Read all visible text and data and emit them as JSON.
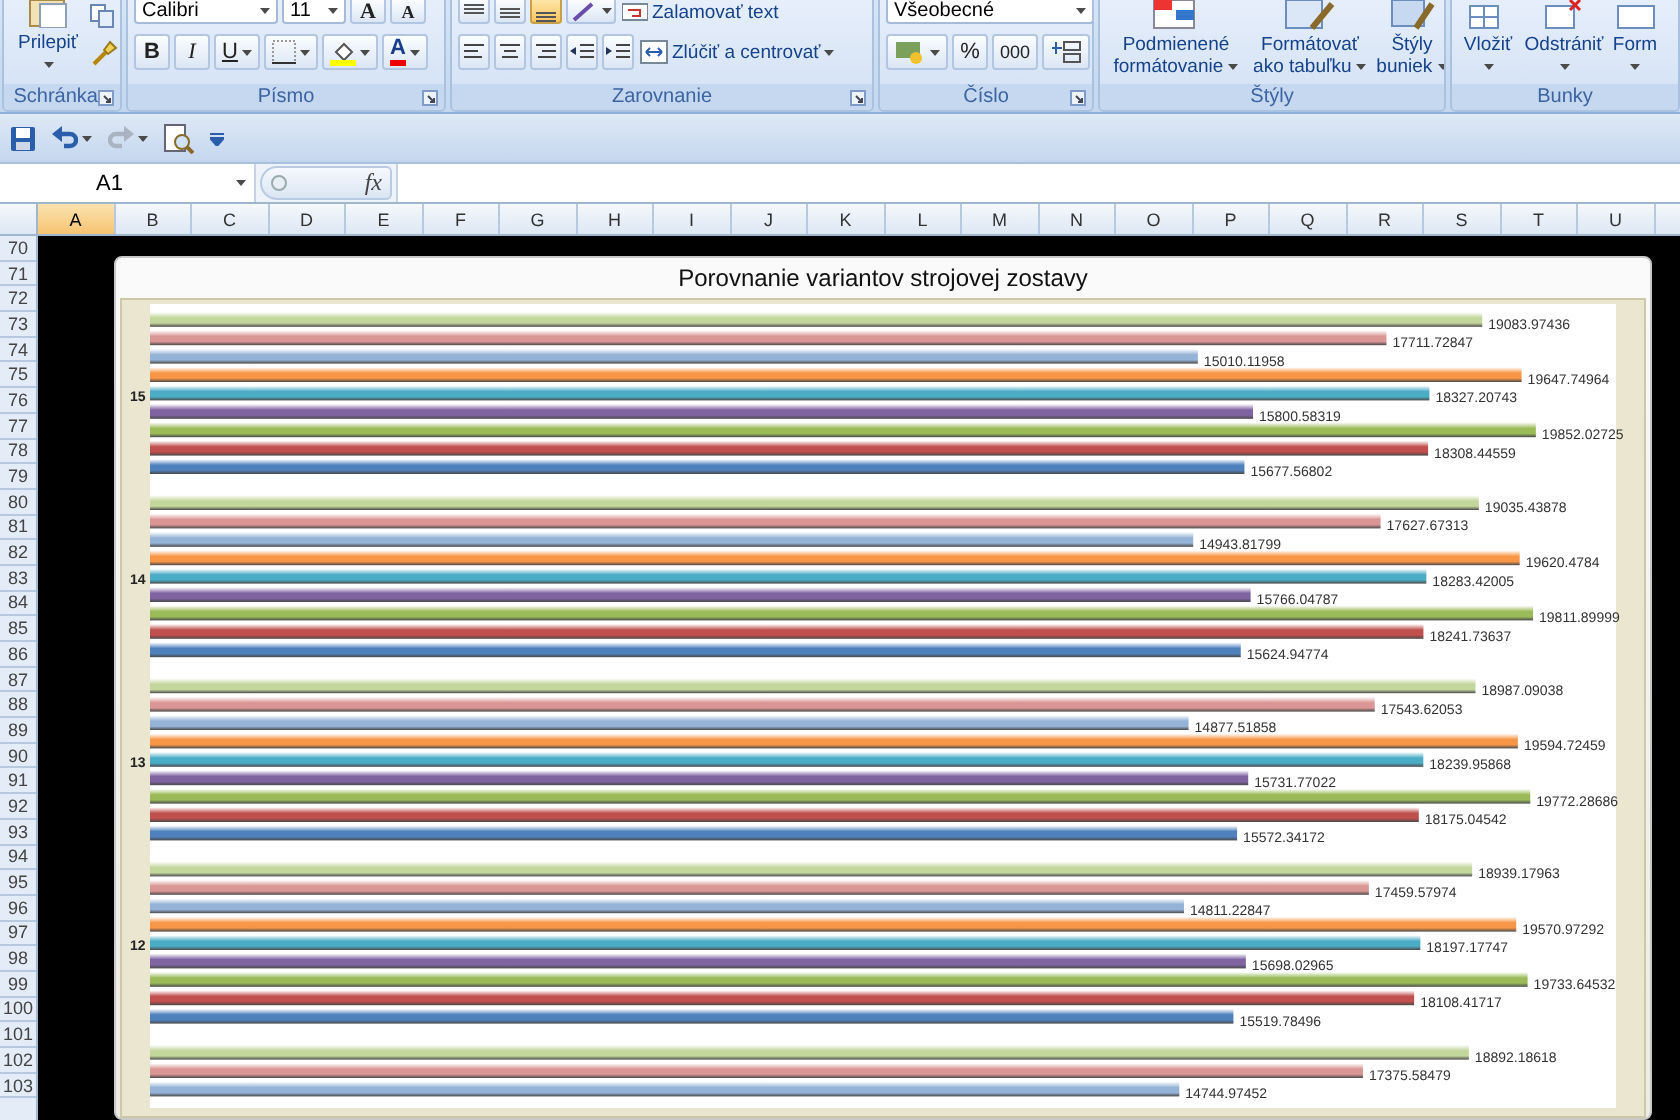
{
  "ribbon": {
    "groups": [
      {
        "kind": "clipboard",
        "label": "Schránka",
        "paste": "Prilepiť"
      },
      {
        "kind": "font",
        "label": "Písmo",
        "font_name": "Calibri",
        "font_size": "11",
        "grow": "A",
        "shrink": "A",
        "bold": "B",
        "italic": "I",
        "underline": "U",
        "font_color": "A"
      },
      {
        "kind": "alignment",
        "label": "Zarovnanie",
        "vertical_align": [
          {
            "selected": false
          },
          {
            "selected": false
          },
          {
            "selected": true
          }
        ],
        "wrap_text": "Zalamovať text",
        "merge": "Zlúčiť a centrovať"
      },
      {
        "kind": "number",
        "label": "Číslo",
        "format": "Všeobecné",
        "percent": "%",
        "thousands": "000"
      },
      {
        "kind": "styles",
        "label": "Štýly",
        "buttons": [
          "Podmienené formátovanie",
          "Formátovať ako tabuľku",
          "Štýly buniek"
        ]
      },
      {
        "kind": "cells",
        "label": "Bunky",
        "buttons": [
          "Vložiť",
          "Odstrániť",
          "Form"
        ]
      }
    ]
  },
  "quick_access": [
    {
      "kind": "save",
      "disabled": false
    },
    {
      "kind": "undo",
      "disabled": false
    },
    {
      "kind": "redo",
      "disabled": true
    },
    {
      "kind": "print_preview",
      "disabled": false
    },
    {
      "kind": "customize",
      "disabled": false
    }
  ],
  "formula_bar": {
    "name_box": "A1",
    "function_button": "fx"
  },
  "columns": [
    {
      "label": "A",
      "selected": true
    },
    {
      "label": "B",
      "selected": false
    },
    {
      "label": "C",
      "selected": false
    },
    {
      "label": "D",
      "selected": false
    },
    {
      "label": "E",
      "selected": false
    },
    {
      "label": "F",
      "selected": false
    },
    {
      "label": "G",
      "selected": false
    },
    {
      "label": "H",
      "selected": false
    },
    {
      "label": "I",
      "selected": false
    },
    {
      "label": "J",
      "selected": false
    },
    {
      "label": "K",
      "selected": false
    },
    {
      "label": "L",
      "selected": false
    },
    {
      "label": "M",
      "selected": false
    },
    {
      "label": "N",
      "selected": false
    },
    {
      "label": "O",
      "selected": false
    },
    {
      "label": "P",
      "selected": false
    },
    {
      "label": "Q",
      "selected": false
    },
    {
      "label": "R",
      "selected": false
    },
    {
      "label": "S",
      "selected": false
    },
    {
      "label": "T",
      "selected": false
    },
    {
      "label": "U",
      "selected": false
    }
  ],
  "rows": [
    "70",
    "71",
    "72",
    "73",
    "74",
    "75",
    "76",
    "77",
    "78",
    "79",
    "80",
    "81",
    "82",
    "83",
    "84",
    "85",
    "86",
    "87",
    "88",
    "89",
    "90",
    "91",
    "92",
    "93",
    "94",
    "95",
    "96",
    "97",
    "98",
    "99",
    "100",
    "101",
    "102",
    "103"
  ],
  "chart": {
    "chart_data": {
      "type": "bar",
      "orientation": "horizontal",
      "title": "Porovnanie variantov strojovej zostavy",
      "categories": [
        "15",
        "14",
        "13",
        "12",
        null
      ],
      "xlim": [
        0,
        21000
      ],
      "data_labels": true,
      "series": [
        {
          "color": "#c3d69b",
          "values": [
            19083.97436,
            19035.43878,
            18987.09038,
            18939.17963,
            18892.18618
          ]
        },
        {
          "color": "#d99694",
          "values": [
            17711.72847,
            17627.67313,
            17543.62053,
            17459.57974,
            17375.58479
          ]
        },
        {
          "color": "#95b3d7",
          "values": [
            15010.11958,
            14943.81799,
            14877.51858,
            14811.22847,
            14744.97452
          ]
        },
        {
          "color": "#f79646",
          "values": [
            19647.74964,
            19620.4784,
            19594.72459,
            19570.97292,
            null
          ]
        },
        {
          "color": "#4bacc6",
          "values": [
            18327.20743,
            18283.42005,
            18239.95868,
            18197.17747,
            null
          ]
        },
        {
          "color": "#8064a2",
          "values": [
            15800.58319,
            15766.04787,
            15731.77022,
            15698.02965,
            null
          ]
        },
        {
          "color": "#9bbb59",
          "values": [
            19852.02725,
            19811.89999,
            19772.28686,
            19733.64532,
            null
          ]
        },
        {
          "color": "#c0504d",
          "values": [
            18308.44559,
            18241.73637,
            18175.04542,
            18108.41717,
            null
          ]
        },
        {
          "color": "#4f81bd",
          "values": [
            15677.56802,
            15624.94774,
            15572.34172,
            15519.78496,
            null
          ]
        }
      ]
    }
  }
}
